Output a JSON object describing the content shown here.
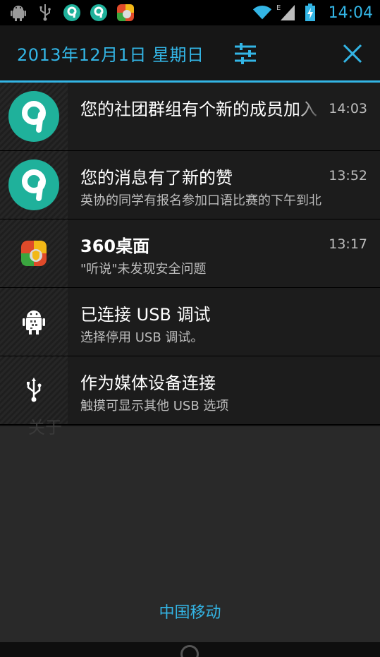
{
  "status_bar": {
    "clock": "14:04",
    "network_label": "E",
    "icons": [
      "android-debug-icon",
      "usb-icon",
      "app-9-icon",
      "app-9-icon",
      "360-icon",
      "wifi-icon",
      "signal-icon",
      "battery-charging-icon"
    ]
  },
  "header": {
    "date": "2013年12月1日 星期日",
    "settings_icon": "sliders-icon",
    "close_icon": "close-icon"
  },
  "notifications": [
    {
      "title": "您的社团群组有个新的成员加入",
      "text": "",
      "time": "14:03",
      "icon": "app-9-icon"
    },
    {
      "title": "您的消息有了新的赞",
      "text": "英协的同学有报名参加口语比赛的下午到北",
      "time": "13:52",
      "icon": "app-9-icon"
    },
    {
      "title": "360桌面",
      "text": "\"听说\"未发现安全问题",
      "time": "13:17",
      "icon": "360-icon"
    },
    {
      "title": "已连接 USB 调试",
      "text": "选择停用 USB 调试。",
      "time": "",
      "icon": "android-debug-icon"
    },
    {
      "title": "作为媒体设备连接",
      "text": "触摸可显示其他 USB 选项",
      "time": "",
      "icon": "usb-icon"
    }
  ],
  "background_ghost_text": "关于",
  "carrier": "中国移动",
  "colors": {
    "accent": "#33b5e5",
    "teal": "#1fb19b"
  }
}
